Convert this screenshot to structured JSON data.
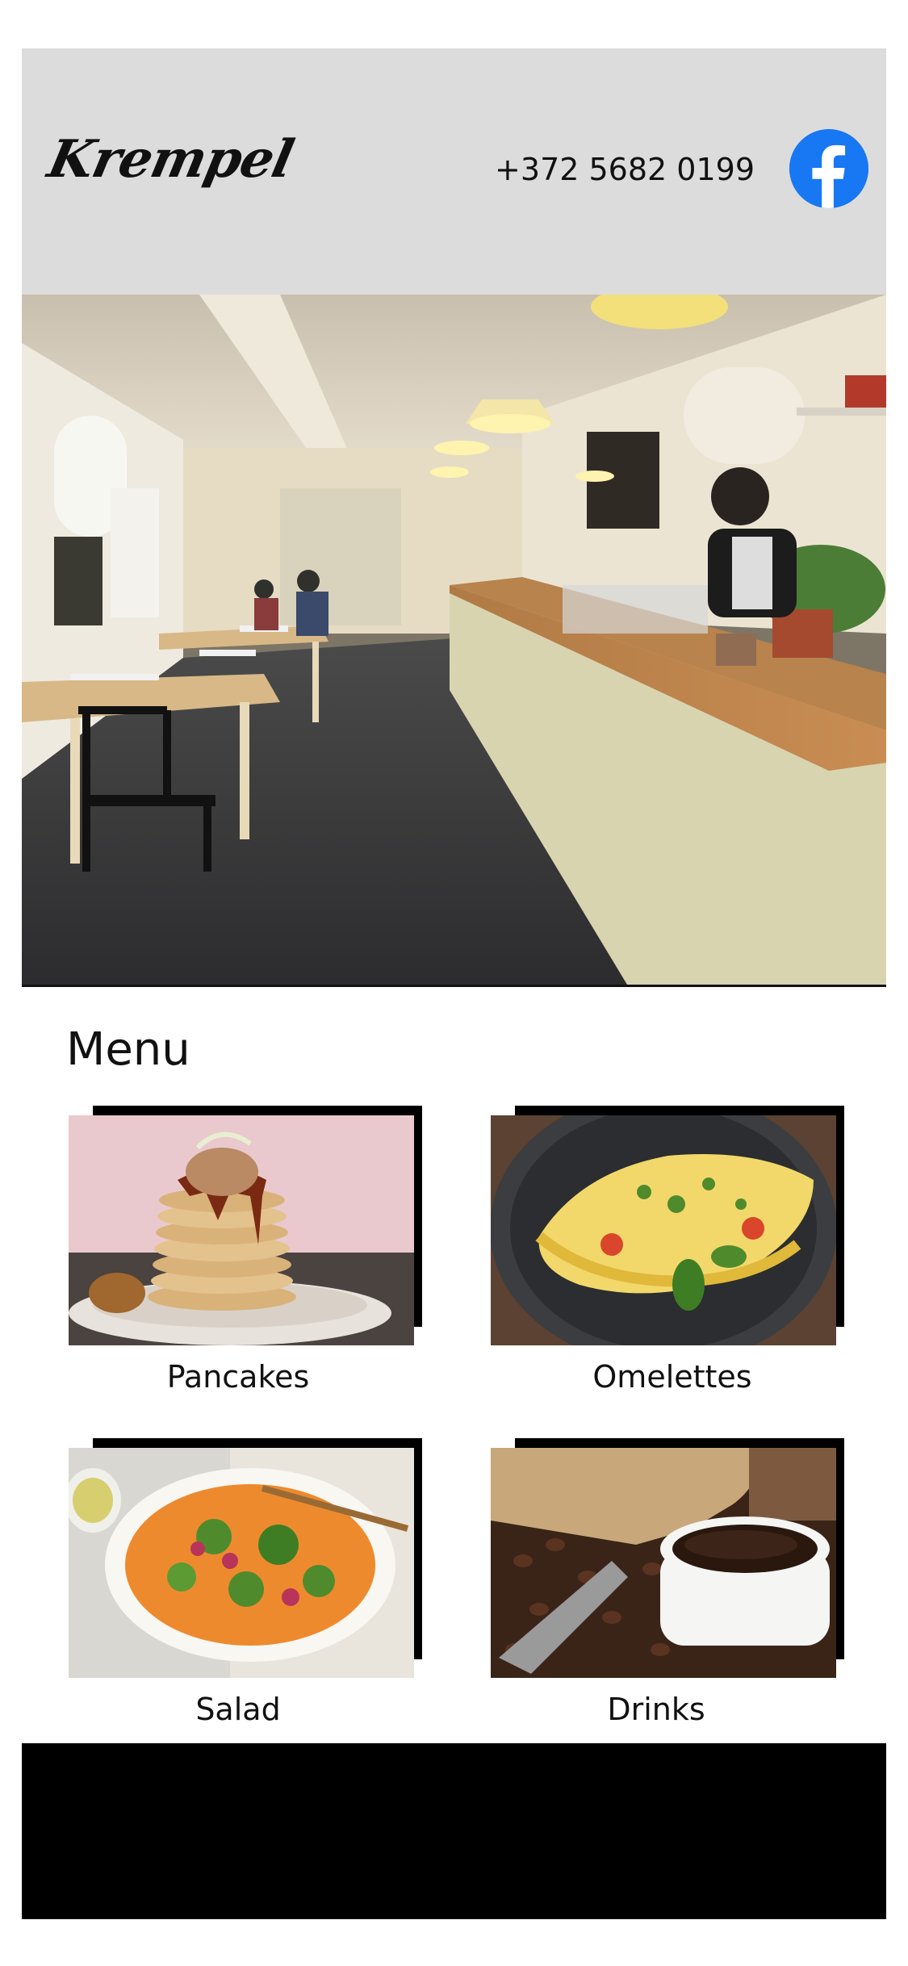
{
  "header": {
    "logo_text": "Krempel",
    "phone": "+372 5682 0199",
    "facebook_icon": "facebook-icon",
    "facebook_color": "#1877f2",
    "background_color": "#dcdcdc"
  },
  "hero": {
    "image": "cafe-interior-photo"
  },
  "menu": {
    "title": "Menu",
    "items": [
      {
        "label": "Pancakes",
        "image": "pancakes-photo"
      },
      {
        "label": "Omelettes",
        "image": "omelette-photo"
      },
      {
        "label": "Salad",
        "image": "salad-photo"
      },
      {
        "label": "Drinks",
        "image": "coffee-photo"
      }
    ]
  },
  "footer": {
    "background_color": "#000000"
  }
}
